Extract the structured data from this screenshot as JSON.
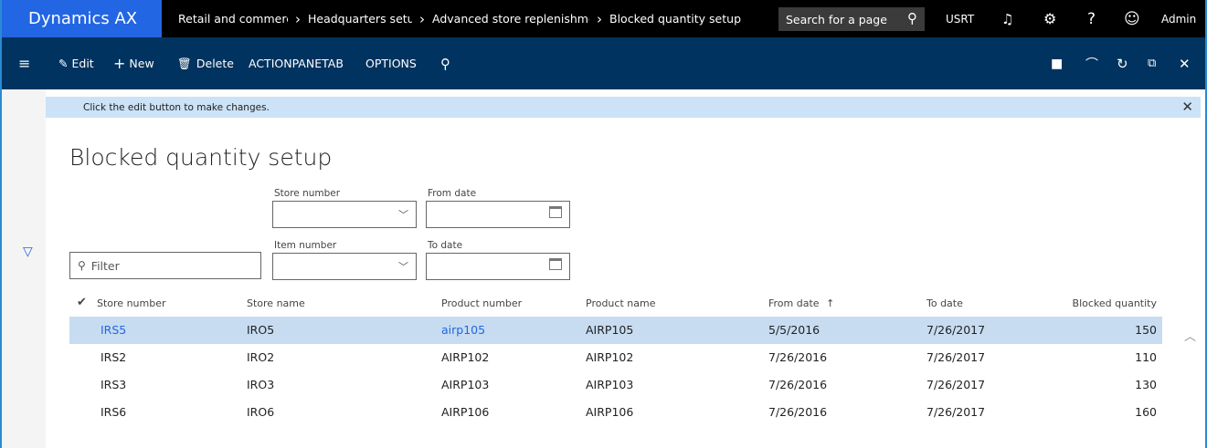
{
  "app": {
    "brand": "Dynamics AX",
    "breadcrumbs": [
      "Retail and commerc",
      "Headquarters setu",
      "Advanced store replenishme",
      "Blocked quantity setup"
    ],
    "search_placeholder": "Search for a page",
    "company": "USRT",
    "user": "Admin"
  },
  "actions": {
    "edit": "Edit",
    "new": "New",
    "delete": "Delete",
    "actionpanetab": "ACTIONPANETAB",
    "options": "OPTIONS"
  },
  "info": {
    "message": "Click the edit button to make changes."
  },
  "page": {
    "title": "Blocked quantity setup",
    "filter_placeholder": "Filter",
    "store_number_label": "Store number",
    "item_number_label": "Item number",
    "from_date_label": "From date",
    "to_date_label": "To date"
  },
  "grid": {
    "columns": [
      "Store number",
      "Store name",
      "Product number",
      "Product name",
      "From date",
      "To date",
      "Blocked quantity"
    ],
    "sort_indicator": "↑",
    "rows": [
      {
        "store_number": "IRS5",
        "store_name": "IRO5",
        "product_number": "airp105",
        "product_name": "AIRP105",
        "from_date": "5/5/2016",
        "to_date": "7/26/2017",
        "qty": "150",
        "selected": true
      },
      {
        "store_number": "IRS2",
        "store_name": "IRO2",
        "product_number": "AIRP102",
        "product_name": "AIRP102",
        "from_date": "7/26/2016",
        "to_date": "7/26/2017",
        "qty": "110",
        "selected": false
      },
      {
        "store_number": "IRS3",
        "store_name": "IRO3",
        "product_number": "AIRP103",
        "product_name": "AIRP103",
        "from_date": "7/26/2016",
        "to_date": "7/26/2017",
        "qty": "130",
        "selected": false
      },
      {
        "store_number": "IRS6",
        "store_name": "IRO6",
        "product_number": "AIRP106",
        "product_name": "AIRP106",
        "from_date": "7/26/2016",
        "to_date": "7/26/2017",
        "qty": "160",
        "selected": false
      }
    ]
  },
  "colors": {
    "brand": "#2266e3",
    "selected_row": "#c7dcf1",
    "action_bar": "#1b3a66",
    "info_bar": "#cce2f7"
  }
}
